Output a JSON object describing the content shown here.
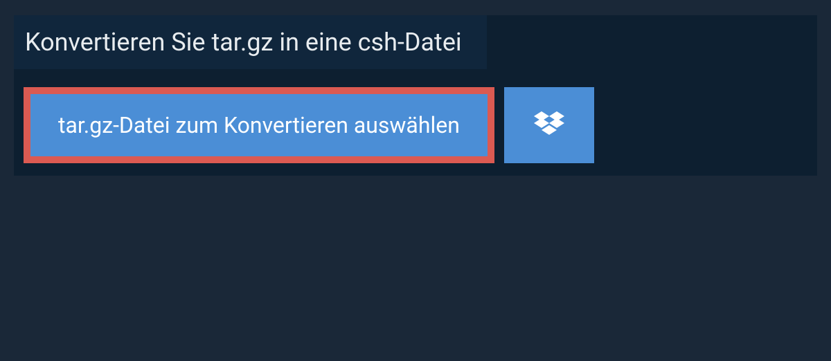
{
  "header": {
    "title": "Konvertieren Sie tar.gz in eine csh-Datei"
  },
  "actions": {
    "select_file_label": "tar.gz-Datei zum Konvertieren auswählen"
  },
  "colors": {
    "page_bg": "#1a2838",
    "panel_bg": "#0d1f30",
    "header_bg": "#10263c",
    "button_bg": "#4b8ed6",
    "highlight_border": "#db5a52",
    "text_light": "#e8ecef",
    "text_white": "#ffffff"
  }
}
